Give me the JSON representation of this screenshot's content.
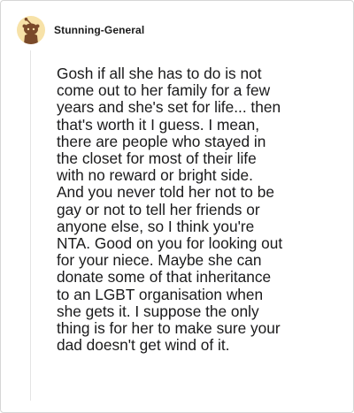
{
  "comment": {
    "username": "Stunning-General",
    "avatar_icon": "snoo-avatar-icon",
    "text": "Gosh if all she has to do is not\ncome out to her family for a few\nyears and she's set for life... then\nthat's worth it I guess. I mean,\nthere are people who stayed in\nthe closet for most of their life\nwith no reward or bright side.\nAnd you never told her not to be\ngay or not to tell her friends or\nanyone else, so I think you're\nNTA. Good on you for looking out\nfor your niece. Maybe she can\ndonate some of that inheritance\nto an LGBT organisation when\nshe gets it. I suppose the only\nthing is for her to make sure your\ndad doesn't get wind of it."
  },
  "colors": {
    "avatar_bg": "#f7e2a8",
    "avatar_figure": "#7a4a2a",
    "text": "#1a1a1b",
    "thread_line": "#e4e4e4"
  }
}
